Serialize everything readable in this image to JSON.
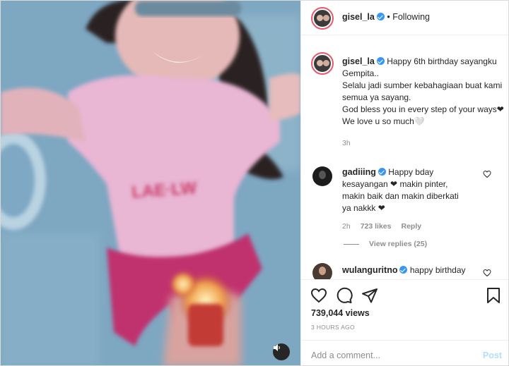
{
  "post": {
    "author": "gisel_la",
    "follow_status": "• Following",
    "caption": "Happy 6th birthday sayangku Gempita..\nSelalu jadi sumber kebahagiaan buat kami semua ya sayang.\nGod bless you in every step of your ways❤\nWe love u so much🤍",
    "caption_time": "3h",
    "views": "739,044 views",
    "posted_time": "3 HOURS AGO"
  },
  "comments": [
    {
      "user": "gadiiing",
      "text": "Happy bday\nkesayangan ❤ makin pinter,\nmakin baik dan makin diberkati\nya nakkk ❤",
      "time": "2h",
      "likes": "723 likes",
      "reply": "Reply",
      "view_replies": "View replies (25)"
    },
    {
      "user": "wulanguritno",
      "text": "happy birthday"
    }
  ],
  "composer": {
    "placeholder": "Add a comment...",
    "post_label": "Post"
  },
  "icons": {
    "like": "heart-icon",
    "comment": "comment-icon",
    "share": "paper-plane-icon",
    "save": "bookmark-icon",
    "sound": "speaker-icon"
  },
  "colors": {
    "verified": "#3897f0",
    "story_ring": "#e75a6e",
    "post_disabled": "#b2dffc"
  }
}
